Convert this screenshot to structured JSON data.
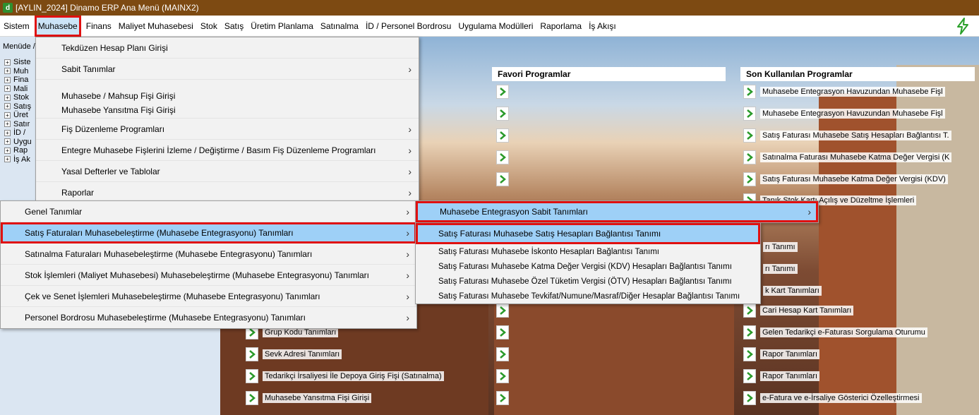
{
  "window": {
    "title": "[AYLIN_2024] Dinamo ERP Ana Menü (MAINX2)",
    "icon_letter": "d"
  },
  "menubar": [
    "Sistem",
    "Muhasebe",
    "Finans",
    "Maliyet Muhasebesi",
    "Stok",
    "Satış",
    "Üretim Planlama",
    "Satınalma",
    "İD / Personel Bordrosu",
    "Uygulama Modülleri",
    "Raporlama",
    "İş Akışı"
  ],
  "left_panel": {
    "header": "Menüde /",
    "tree": [
      "Siste",
      "Muh",
      "Fina",
      "Mali",
      "Stok",
      "Satış",
      "Üret",
      "Satır",
      "İD /",
      "Uygu",
      "Rap",
      "İş Ak"
    ]
  },
  "favorites": {
    "title": "Favori Programlar"
  },
  "recent": {
    "title": "Son Kullanılan Programlar",
    "items": [
      "Muhasebe Entegrasyon Havuzundan Muhasebe Fişl",
      "Muhasebe Entegrasyon Havuzundan Muhasebe Fişl",
      "Satış Faturası Muhasebe Satış Hesapları Bağlantısı T.",
      "Satınalma Faturası Muhasebe Katma Değer Vergisi (K",
      "Satış Faturası Muhasebe Katma Değer Vergisi (KDV)",
      "Tanık Stok Kartı Açılış ve Düzeltme İşlemleri",
      "",
      "",
      "",
      "Cari Hesap Kart Tanımları",
      "Gelen Tedarikçi e-Faturası Sorgulama Oturumu",
      "Rapor Tanımları",
      "Rapor Tanımları",
      "e-Fatura ve e-İrsaliye Gösterici Özelleştirmesi"
    ],
    "partial_items": [
      "rı Tanımı",
      "rı Tanımı",
      "k Kart Tanımları"
    ]
  },
  "left_programs": [
    "Grup Kodu Tanımları",
    "Sevk Adresi Tanımları",
    "Tedarikçi İrsaliyesi İle Depoya Giriş Fişi (Satınalma)",
    "Muhasebe Yansıtma Fişi Girişi"
  ],
  "muhasebe_menu": [
    {
      "label": "Tekdüzen Hesap Planı Girişi",
      "sub": false
    },
    {
      "label": "Sabit Tanımlar",
      "sub": true
    },
    {
      "label": "Muhasebe / Mahsup Fişi Girişi",
      "sub": false
    },
    {
      "label": "Muhasebe Yansıtma Fişi Girişi",
      "sub": false
    },
    {
      "label": "Fiş Düzenleme Programları",
      "sub": true
    },
    {
      "label": "Entegre Muhasebe Fişlerini İzleme / Değiştirme / Basım Fiş Düzenleme Programları",
      "sub": true
    },
    {
      "label": "Yasal Defterler ve Tablolar",
      "sub": true
    },
    {
      "label": "Raporlar",
      "sub": true
    }
  ],
  "genel_menu": [
    {
      "label": "Genel Tanımlar",
      "sub": true
    },
    {
      "label": "Satış Faturaları Muhasebeleştirme (Muhasebe Entegrasyonu) Tanımları",
      "sub": true
    },
    {
      "label": "Satınalma Faturaları Muhasebeleştirme (Muhasebe Entegrasyonu) Tanımları",
      "sub": true
    },
    {
      "label": "Stok İşlemleri (Maliyet Muhasebesi) Muhasebeleştirme (Muhasebe Entegrasyonu) Tanımları",
      "sub": true
    },
    {
      "label": "Çek ve Senet İşlemleri Muhasebeleştirme (Muhasebe Entegrasyonu) Tanımları",
      "sub": true
    },
    {
      "label": "Personel Bordrosu Muhasebeleştirme (Muhasebe Entegrasyonu) Tanımları",
      "sub": true
    }
  ],
  "entegrasyon_menu": {
    "label": "Muhasebe Entegrasyon Sabit Tanımları"
  },
  "satis_menu": [
    "Satış Faturası Muhasebe Satış Hesapları Bağlantısı Tanımı",
    "Satış Faturası Muhasebe İskonto Hesapları Bağlantısı Tanımı",
    "Satış Faturası Muhasebe Katma Değer Vergisi (KDV) Hesapları Bağlantısı Tanımı",
    "Satış Faturası Muhasebe Özel Tüketim Vergisi (ÖTV) Hesapları Bağlantısı Tanımı",
    "Satış Faturası Muhasebe Tevkifat/Numune/Masraf/Diğer Hesaplar Bağlantısı Tanımı"
  ],
  "colors": {
    "titlebar": "#7d4a12",
    "highlight": "#9ed0f7",
    "annotation": "#e01010"
  }
}
